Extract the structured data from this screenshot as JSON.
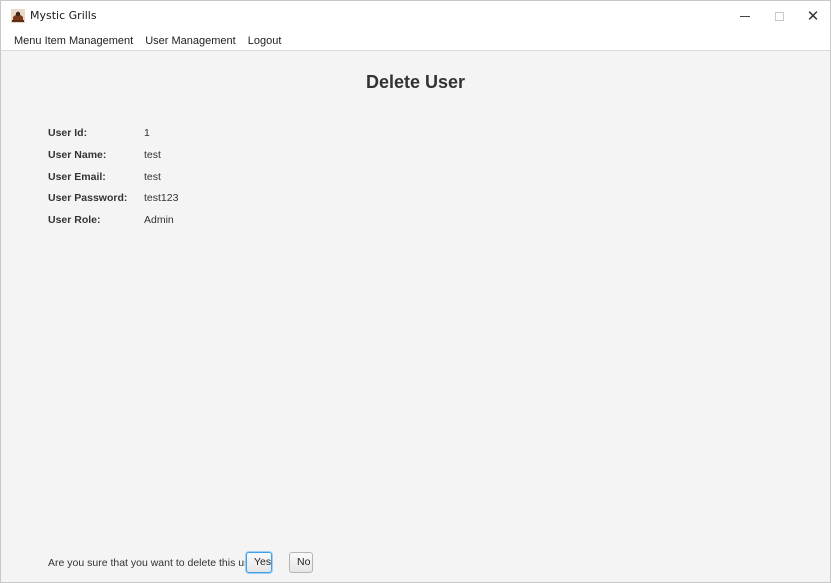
{
  "window": {
    "title": "Mystic Grills",
    "controls": {
      "minimize": "minimize-icon",
      "maximize": "maximize-icon",
      "close": "✕"
    }
  },
  "menubar": {
    "items": [
      "Menu Item Management",
      "User Management",
      "Logout"
    ]
  },
  "page": {
    "title": "Delete User",
    "fields": [
      {
        "label": "User Id:",
        "value": "1"
      },
      {
        "label": "User Name:",
        "value": "test"
      },
      {
        "label": "User Email:",
        "value": "test"
      },
      {
        "label": "User Password:",
        "value": "test123"
      },
      {
        "label": "User Role:",
        "value": "Admin"
      }
    ],
    "confirm": {
      "question": "Are you sure that you want to delete this user?",
      "yes_label": "Yes",
      "no_label": "No"
    }
  },
  "colors": {
    "background": "#f4f4f4",
    "focus_border": "#3ea0e6"
  }
}
